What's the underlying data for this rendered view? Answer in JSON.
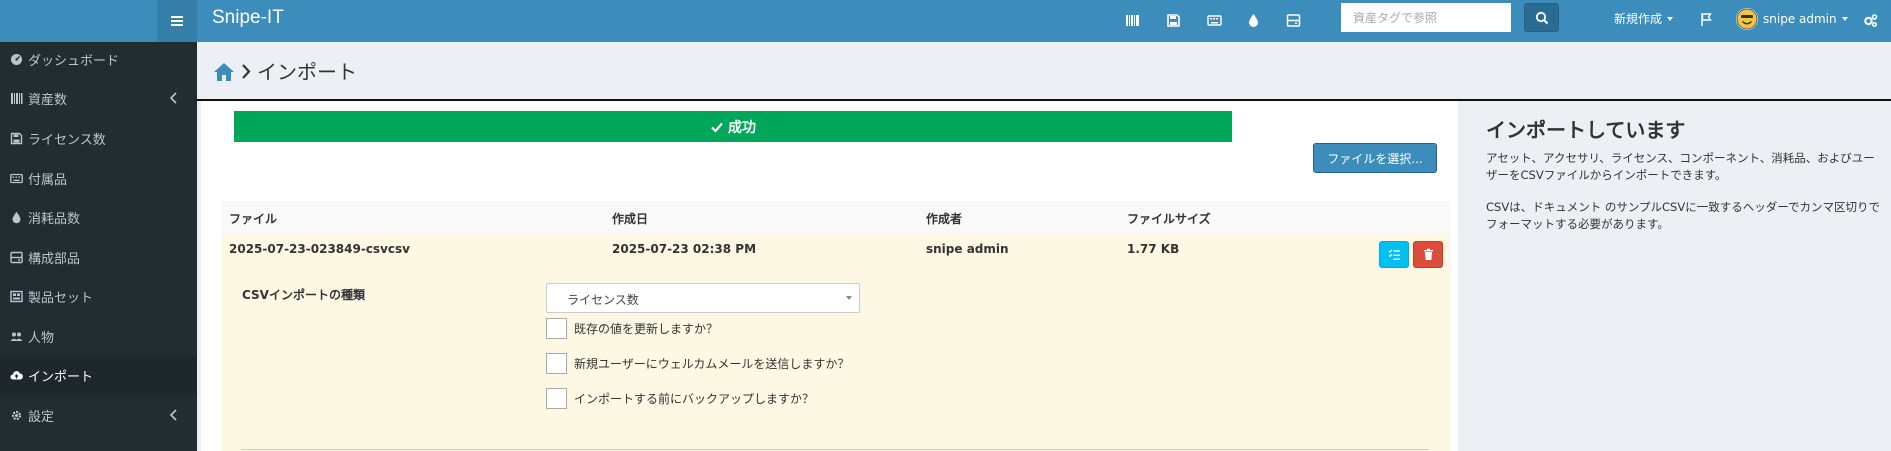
{
  "app": {
    "brand": "Snipe-IT"
  },
  "topbar": {
    "icons": [
      "assets-icon",
      "licenses-icon",
      "accessories-icon",
      "consumables-icon",
      "components-icon"
    ],
    "search_placeholder": "資産タグで参照",
    "create_new_label": "新規作成",
    "user_label": "snipe admin"
  },
  "sidebar": {
    "items": [
      {
        "label": "ダッシュボード",
        "icon": "dashboard-icon"
      },
      {
        "label": "資産数",
        "icon": "barcode-icon",
        "has_submenu": true
      },
      {
        "label": "ライセンス数",
        "icon": "save-icon"
      },
      {
        "label": "付属品",
        "icon": "keyboard-icon"
      },
      {
        "label": "消耗品数",
        "icon": "tint-icon"
      },
      {
        "label": "構成部品",
        "icon": "hdd-icon"
      },
      {
        "label": "製品セット",
        "icon": "kit-icon"
      },
      {
        "label": "人物",
        "icon": "users-icon"
      },
      {
        "label": "インポート",
        "icon": "cloud-upload-icon",
        "active": true
      },
      {
        "label": "設定",
        "icon": "cog-icon",
        "has_submenu": true
      }
    ]
  },
  "header": {
    "title": "インポート"
  },
  "main": {
    "success_label": "成功",
    "select_file_label": "ファイルを選択...",
    "table": {
      "columns": [
        "ファイル",
        "作成日",
        "作成者",
        "ファイルサイズ"
      ],
      "rows": [
        {
          "file": "2025-07-23-023849-csvcsv",
          "created": "2025-07-23 02:38 PM",
          "author": "snipe admin",
          "size": "1.77 KB"
        }
      ]
    },
    "import_form": {
      "type_label": "CSVインポートの種類",
      "type_selected": "ライセンス数",
      "checkboxes": [
        {
          "label": "既存の値を更新しますか？",
          "checked": false
        },
        {
          "label": "新規ユーザーにウェルカムメールを送信しますか？",
          "checked": false
        },
        {
          "label": "インポートする前にバックアップしますか？",
          "checked": false
        }
      ]
    }
  },
  "info": {
    "title": "インポートしています",
    "paragraph1": "アセット、アクセサリ、ライセンス、コンポーネント、消耗品、およびユーザーをCSVファイルからインポートできます。",
    "paragraph2": "CSVは、ドキュメント のサンプルCSVに一致するヘッダーでカンマ区切りでフォーマットする必要があります。"
  },
  "colors": {
    "navbar": "#3c8dbc",
    "sidebar": "#222d32",
    "success": "#00a65a",
    "info_button": "#00c0ef",
    "danger_button": "#dd4b39",
    "row_highlight": "#fcf8e3"
  }
}
